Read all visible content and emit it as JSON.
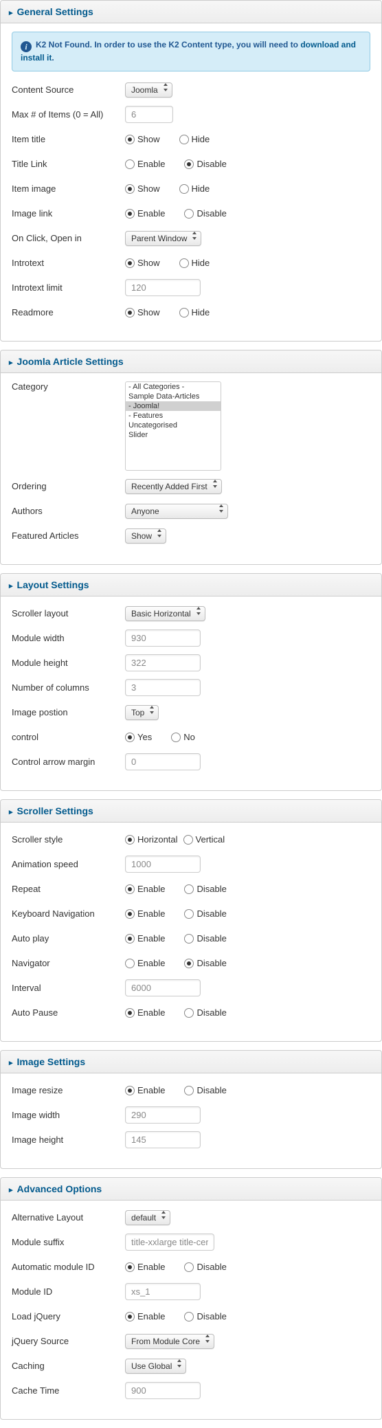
{
  "general": {
    "title": "General Settings",
    "info_text_1": "K2 Not Found. In order to use the K2 Content type, you will need to ",
    "info_link": "download and install it",
    "info_text_2": ".",
    "rows": {
      "content_source": {
        "label": "Content Source",
        "value": "Joomla"
      },
      "max_items": {
        "label": "Max # of Items (0 = All)",
        "value": "6"
      },
      "item_title": {
        "label": "Item title",
        "opt1": "Show",
        "opt2": "Hide",
        "selected": 1
      },
      "title_link": {
        "label": "Title Link",
        "opt1": "Enable",
        "opt2": "Disable",
        "selected": 2
      },
      "item_image": {
        "label": "Item image",
        "opt1": "Show",
        "opt2": "Hide",
        "selected": 1
      },
      "image_link": {
        "label": "Image link",
        "opt1": "Enable",
        "opt2": "Disable",
        "selected": 1
      },
      "on_click": {
        "label": "On Click, Open in",
        "value": "Parent Window"
      },
      "introtext": {
        "label": "Introtext",
        "opt1": "Show",
        "opt2": "Hide",
        "selected": 1
      },
      "introtext_limit": {
        "label": "Introtext limit",
        "value": "120"
      },
      "readmore": {
        "label": "Readmore",
        "opt1": "Show",
        "opt2": "Hide",
        "selected": 1
      }
    }
  },
  "joomla": {
    "title": "Joomla Article Settings",
    "category_label": "Category",
    "categories": {
      "i0": "- All Categories -",
      "i1": "Sample Data-Articles",
      "i2": "- Joomla!",
      "i3": "- Features",
      "i4": "Uncategorised",
      "i5": "Slider"
    },
    "ordering": {
      "label": "Ordering",
      "value": "Recently Added First"
    },
    "authors": {
      "label": "Authors",
      "value": "Anyone"
    },
    "featured": {
      "label": "Featured Articles",
      "value": "Show"
    }
  },
  "layout": {
    "title": "Layout Settings",
    "scroller_layout": {
      "label": "Scroller layout",
      "value": "Basic Horizontal"
    },
    "module_width": {
      "label": "Module width",
      "value": "930"
    },
    "module_height": {
      "label": "Module height",
      "value": "322"
    },
    "num_columns": {
      "label": "Number of columns",
      "value": "3"
    },
    "image_position": {
      "label": "Image postion",
      "value": "Top"
    },
    "control": {
      "label": "control",
      "opt1": "Yes",
      "opt2": "No",
      "selected": 1
    },
    "control_margin": {
      "label": "Control arrow margin",
      "value": "0"
    }
  },
  "scroller": {
    "title": "Scroller Settings",
    "style": {
      "label": "Scroller style",
      "opt1": "Horizontal",
      "opt2": "Vertical",
      "selected": 1
    },
    "speed": {
      "label": "Animation speed",
      "value": "1000"
    },
    "repeat": {
      "label": "Repeat",
      "opt1": "Enable",
      "opt2": "Disable",
      "selected": 1
    },
    "keyboard": {
      "label": "Keyboard Navigation",
      "opt1": "Enable",
      "opt2": "Disable",
      "selected": 1
    },
    "autoplay": {
      "label": "Auto play",
      "opt1": "Enable",
      "opt2": "Disable",
      "selected": 1
    },
    "navigator": {
      "label": "Navigator",
      "opt1": "Enable",
      "opt2": "Disable",
      "selected": 2
    },
    "interval": {
      "label": "Interval",
      "value": "6000"
    },
    "autopause": {
      "label": "Auto Pause",
      "opt1": "Enable",
      "opt2": "Disable",
      "selected": 1
    }
  },
  "image": {
    "title": "Image Settings",
    "resize": {
      "label": "Image resize",
      "opt1": "Enable",
      "opt2": "Disable",
      "selected": 1
    },
    "width": {
      "label": "Image width",
      "value": "290"
    },
    "height": {
      "label": "Image height",
      "value": "145"
    }
  },
  "advanced": {
    "title": "Advanced Options",
    "alt_layout": {
      "label": "Alternative Layout",
      "value": "default"
    },
    "suffix": {
      "label": "Module suffix",
      "value": "title-xxlarge title-cen"
    },
    "auto_id": {
      "label": "Automatic module ID",
      "opt1": "Enable",
      "opt2": "Disable",
      "selected": 1
    },
    "module_id": {
      "label": "Module ID",
      "value": "xs_1"
    },
    "load_jquery": {
      "label": "Load jQuery",
      "opt1": "Enable",
      "opt2": "Disable",
      "selected": 1
    },
    "jquery_source": {
      "label": "jQuery Source",
      "value": "From Module Core"
    },
    "caching": {
      "label": "Caching",
      "value": "Use Global"
    },
    "cache_time": {
      "label": "Cache Time",
      "value": "900"
    }
  }
}
